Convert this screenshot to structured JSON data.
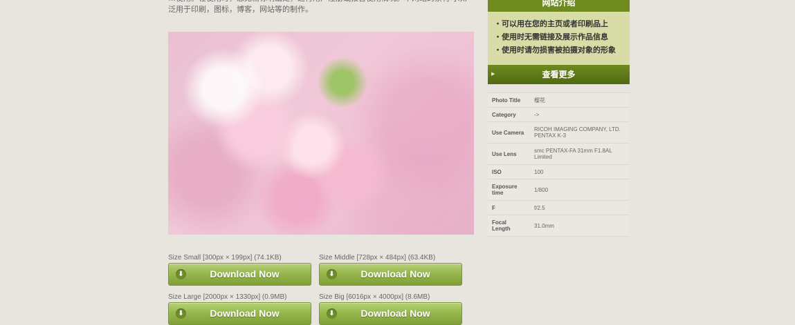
{
  "intro_text": "…使用。在使用时，您无需标明出处，进行用户注册或报告使用情况。本网站的素材可以广泛用于印刷，图标，博客，网站等的制作。",
  "downloads": [
    {
      "label": "Size Small [300px × 199px] (74.1KB)",
      "button": "Download Now"
    },
    {
      "label": "Size Middle [728px × 484px] (63.4KB)",
      "button": "Download Now"
    },
    {
      "label": "Size Large [2000px × 1330px] (0.9MB)",
      "button": "Download Now"
    },
    {
      "label": "Size Big [6016px × 4000px] (8.6MB)",
      "button": "Download Now"
    }
  ],
  "sidebar": {
    "title": "网站介绍",
    "items": [
      "・可以用在您的主页或者印刷品上",
      "・使用时无需链接及展示作品信息",
      "・使用时请勿损害被拍摄对象的形象"
    ],
    "more_label": "查看更多"
  },
  "specs": [
    {
      "key": "Photo Title",
      "value": "樱花"
    },
    {
      "key": "Category",
      "value": "->"
    },
    {
      "key": "Use Camera",
      "value": "RICOH IMAGING COMPANY, LTD. PENTAX K-3"
    },
    {
      "key": "Use Lens",
      "value": "smc PENTAX-FA 31mm F1.8AL Limited"
    },
    {
      "key": "ISO",
      "value": "100"
    },
    {
      "key": "Exposure time",
      "value": "1/800"
    },
    {
      "key": "F",
      "value": "f/2.5"
    },
    {
      "key": "Focal Length",
      "value": "31.0mm"
    }
  ],
  "colors": {
    "background": "#e8e5df",
    "accent_green": "#6f8a1e",
    "button_green": "#96b84d"
  }
}
